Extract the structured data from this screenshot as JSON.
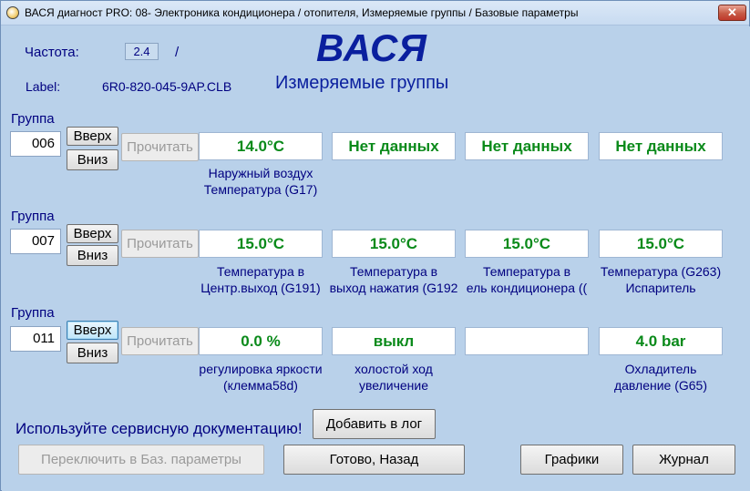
{
  "window": {
    "title": "ВАСЯ диагност PRO: 08- Электроника кондиционера / отопителя,  Измеряемые группы / Базовые параметры",
    "close_label": "✕"
  },
  "header": {
    "freq_label": "Частота:",
    "freq_value": "2.4",
    "freq_slash": "/",
    "label_label": "Label:",
    "label_value": "6R0-820-045-9AP.CLB",
    "brand": "ВАСЯ",
    "page_title": "Измеряемые группы"
  },
  "groups": [
    {
      "label": "Группа",
      "number": "006",
      "up": "Вверх",
      "down": "Вниз",
      "read": "Прочитать",
      "values": [
        "14.0°C",
        "Нет данных",
        "Нет данных",
        "Нет данных"
      ],
      "captions": [
        [
          "Наружный воздух",
          "Температура (G17)"
        ],
        [
          "",
          ""
        ],
        [
          "",
          ""
        ],
        [
          "",
          ""
        ]
      ]
    },
    {
      "label": "Группа",
      "number": "007",
      "up": "Вверх",
      "down": "Вниз",
      "read": "Прочитать",
      "values": [
        "15.0°C",
        "15.0°C",
        "15.0°C",
        "15.0°C"
      ],
      "captions": [
        [
          "Температура в",
          "Центр.выход (G191)"
        ],
        [
          "Температура в",
          "выход нажатия (G192"
        ],
        [
          "Температура в",
          "ель кондиционера (("
        ],
        [
          "Температура (G263)",
          "Испаритель"
        ]
      ]
    },
    {
      "label": "Группа",
      "number": "011",
      "up": "Вверх",
      "down": "Вниз",
      "read": "Прочитать",
      "values": [
        "0.0 %",
        "выкл",
        "",
        "4.0 bar"
      ],
      "captions": [
        [
          "регулировка яркости",
          "(клемма58d)"
        ],
        [
          "холостой ход",
          "увеличение"
        ],
        [
          "",
          ""
        ],
        [
          "Охладитель",
          "давление (G65)"
        ]
      ]
    }
  ],
  "footer": {
    "hint": "Используйте сервисную документацию!",
    "add_log": "Добавить в лог",
    "switch": "Переключить в Баз. параметры",
    "done": "Готово, Назад",
    "charts": "Графики",
    "journal": "Журнал"
  }
}
